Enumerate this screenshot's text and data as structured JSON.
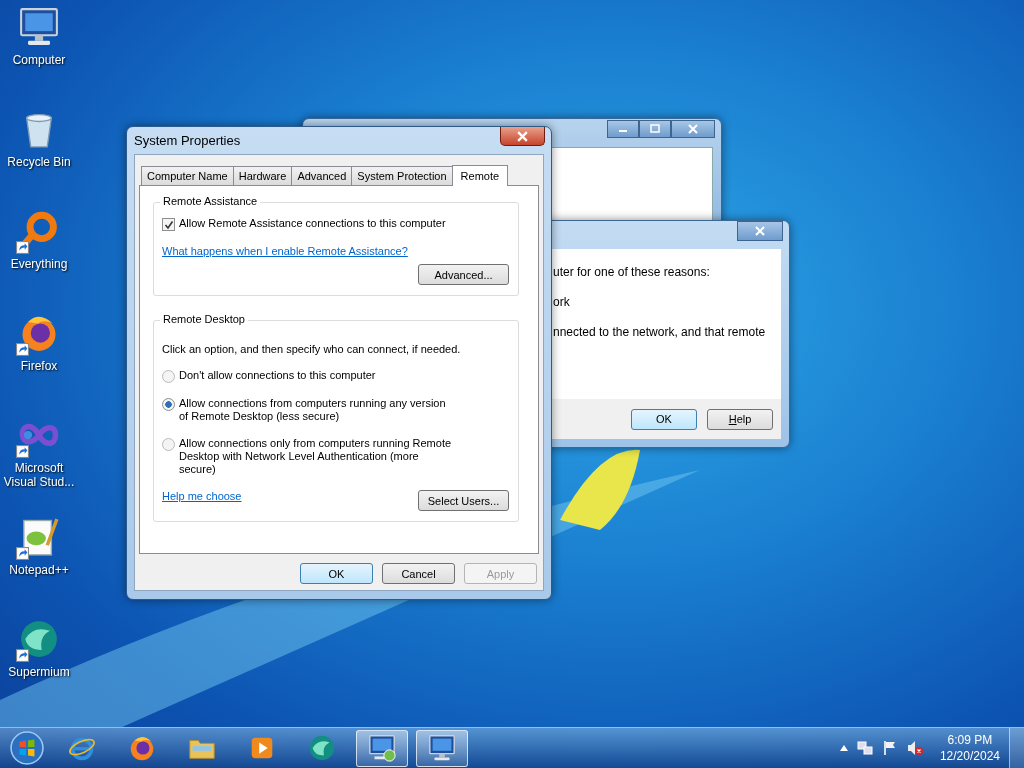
{
  "desktop_icons": [
    {
      "label": "Computer",
      "shortcut": false
    },
    {
      "label": "Recycle Bin",
      "shortcut": false
    },
    {
      "label": "Everything",
      "shortcut": true
    },
    {
      "label": "Firefox",
      "shortcut": true
    },
    {
      "label": "Microsoft Visual Stud...",
      "shortcut": true
    },
    {
      "label": "Notepad++",
      "shortcut": true
    },
    {
      "label": "Supermium",
      "shortcut": true
    }
  ],
  "message_window": {
    "lines": [
      "uter for one of these reasons:",
      "ork",
      "nnected to the network, and that remote"
    ],
    "buttons": [
      {
        "label": "OK",
        "default": true
      },
      {
        "label": "Help",
        "default": false
      }
    ]
  },
  "dialog": {
    "title": "System Properties",
    "tabs": [
      {
        "label": "Computer Name",
        "selected": false
      },
      {
        "label": "Hardware",
        "selected": false
      },
      {
        "label": "Advanced",
        "selected": false
      },
      {
        "label": "System Protection",
        "selected": false
      },
      {
        "label": "Remote",
        "selected": true
      }
    ],
    "remote_assistance": {
      "title": "Remote Assistance",
      "checkbox": {
        "label": "Allow Remote Assistance connections to this computer",
        "checked": true
      },
      "link": "What happens when I enable Remote Assistance?",
      "button": "Advanced..."
    },
    "remote_desktop": {
      "title": "Remote Desktop",
      "instruction": "Click an option, and then specify who can connect, if needed.",
      "options": [
        {
          "label": "Don't allow connections to this computer",
          "selected": false
        },
        {
          "label": "Allow connections from computers running any version of Remote Desktop (less secure)",
          "selected": true
        },
        {
          "label": "Allow connections only from computers running Remote Desktop with Network Level Authentication (more secure)",
          "selected": false
        }
      ],
      "link": "Help me choose",
      "button": "Select Users..."
    },
    "buttons": [
      {
        "label": "OK",
        "default": true,
        "disabled": false
      },
      {
        "label": "Cancel",
        "default": false,
        "disabled": false
      },
      {
        "label": "Apply",
        "default": false,
        "disabled": true
      }
    ]
  },
  "taskbar": {
    "apps": [
      {
        "active": false
      },
      {
        "active": false
      },
      {
        "active": false
      },
      {
        "active": false
      },
      {
        "active": false
      },
      {
        "active": true
      },
      {
        "active": true
      }
    ],
    "clock": {
      "time": "6:09 PM",
      "date": "12/20/2024"
    }
  }
}
